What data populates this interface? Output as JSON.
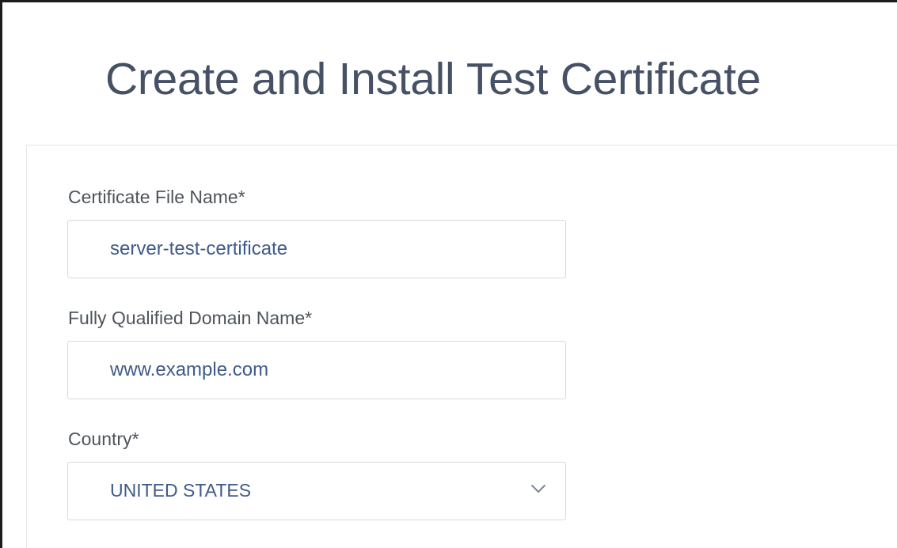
{
  "page": {
    "title": "Create and Install Test Certificate"
  },
  "form": {
    "certificate_file_name": {
      "label": "Certificate File Name*",
      "value": "server-test-certificate"
    },
    "fqdn": {
      "label": "Fully Qualified Domain Name*",
      "value": "www.example.com"
    },
    "country": {
      "label": "Country*",
      "selected": "UNITED STATES",
      "icon": "chevron-down-icon"
    }
  },
  "colors": {
    "title": "#465165",
    "label": "#4e545b",
    "input_text": "#3f5a8a",
    "input_border": "#d5d9de",
    "panel_border": "#e3e6ea"
  }
}
